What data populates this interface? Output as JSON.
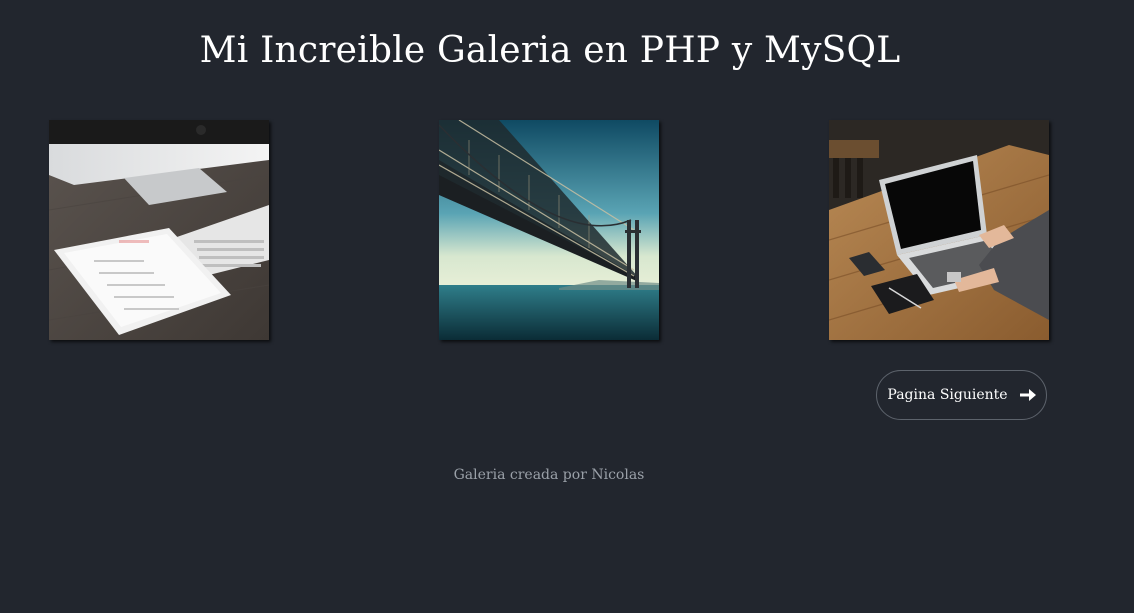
{
  "page": {
    "title": "Mi Increible Galeria en PHP y MySQL"
  },
  "gallery": {
    "images": [
      {
        "name": "desk-tablet-keyboard-photo"
      },
      {
        "name": "suspension-bridge-photo"
      },
      {
        "name": "person-laptop-table-photo"
      }
    ]
  },
  "pagination": {
    "next_label": "Pagina Siguiente",
    "next_icon": "arrow-right-icon"
  },
  "footer": {
    "text": "Galeria creada por Nicolas"
  },
  "colors": {
    "background": "#22262e",
    "footer_text": "#9aa0a8",
    "button_border": "#5d636c"
  }
}
